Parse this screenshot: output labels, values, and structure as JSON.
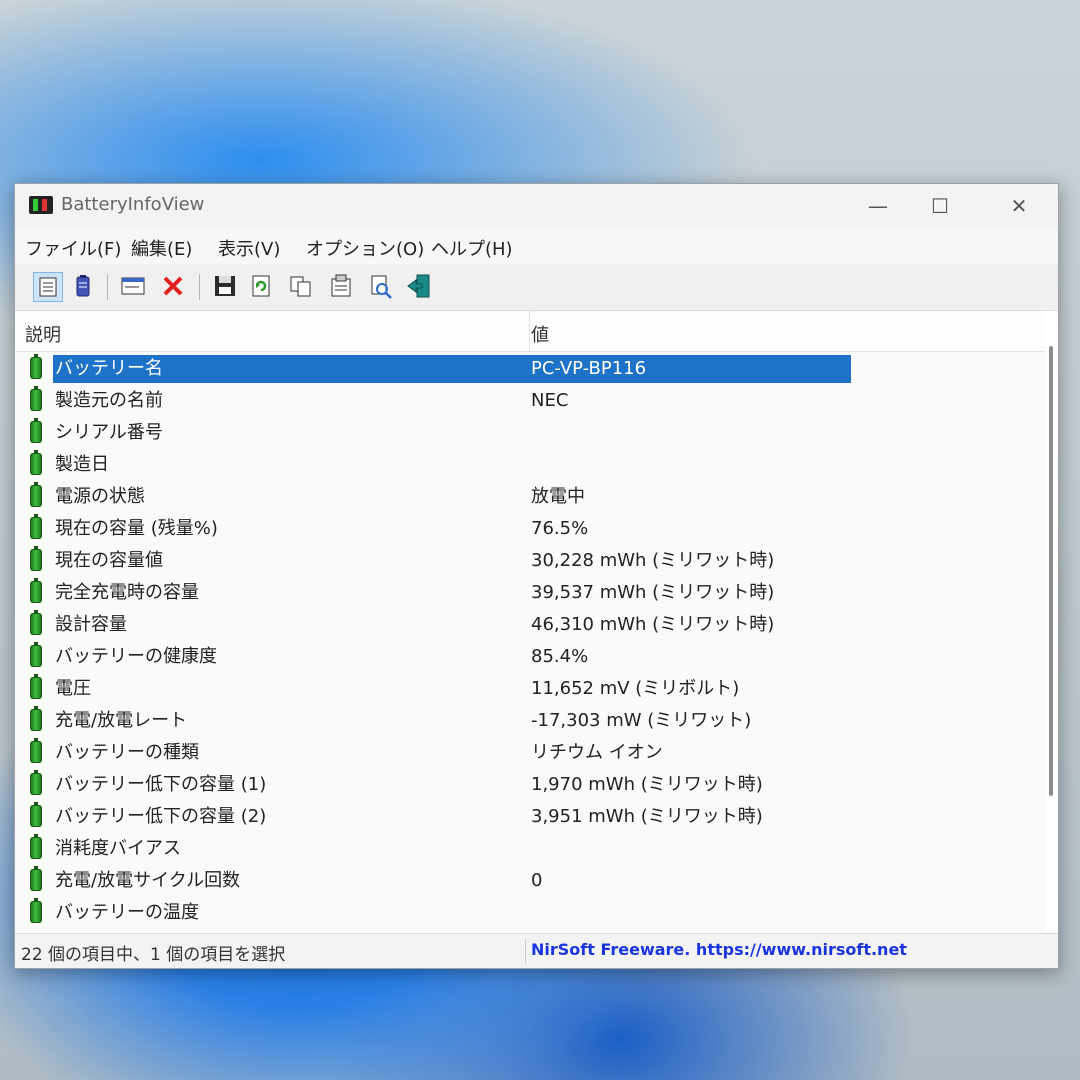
{
  "window": {
    "title": "BatteryInfoView",
    "controls": {
      "minimize": "—",
      "maximize": "☐",
      "close": "✕"
    }
  },
  "menu": [
    "ファイル(F)",
    "編集(E)",
    "表示(V)",
    "オプション(O)",
    "ヘルプ(H)"
  ],
  "toolbar": {
    "buttons": [
      "battery-info-icon",
      "battery-log-icon",
      "window-icon",
      "delete-icon",
      "save-icon",
      "refresh-icon",
      "copy-icon",
      "properties-icon",
      "html-report-icon",
      "exit-icon"
    ]
  },
  "list": {
    "columns": [
      "説明",
      "値"
    ],
    "selected_index": 0,
    "rows": [
      {
        "label": "バッテリー名",
        "value": "PC-VP-BP116"
      },
      {
        "label": "製造元の名前",
        "value": "NEC"
      },
      {
        "label": "シリアル番号",
        "value": ""
      },
      {
        "label": "製造日",
        "value": ""
      },
      {
        "label": "電源の状態",
        "value": "放電中"
      },
      {
        "label": "現在の容量 (残量%)",
        "value": "76.5%"
      },
      {
        "label": "現在の容量値",
        "value": "30,228 mWh (ミリワット時)"
      },
      {
        "label": "完全充電時の容量",
        "value": "39,537 mWh (ミリワット時)"
      },
      {
        "label": "設計容量",
        "value": "46,310 mWh (ミリワット時)"
      },
      {
        "label": "バッテリーの健康度",
        "value": "85.4%"
      },
      {
        "label": "電圧",
        "value": "11,652 mV (ミリボルト)"
      },
      {
        "label": "充電/放電レート",
        "value": "-17,303 mW (ミリワット)"
      },
      {
        "label": "バッテリーの種類",
        "value": "リチウム イオン"
      },
      {
        "label": "バッテリー低下の容量 (1)",
        "value": "1,970 mWh (ミリワット時)"
      },
      {
        "label": "バッテリー低下の容量 (2)",
        "value": "3,951 mWh (ミリワット時)"
      },
      {
        "label": "消耗度バイアス",
        "value": ""
      },
      {
        "label": "充電/放電サイクル回数",
        "value": "0"
      },
      {
        "label": "バッテリーの温度",
        "value": ""
      }
    ]
  },
  "status": {
    "summary": "22 個の項目中、1 個の項目を選択",
    "link": "NirSoft Freeware. https://www.nirsoft.net"
  },
  "colors": {
    "selection": "#1e72c8",
    "link": "#1a35e0",
    "battery_icon": "#2fa52f"
  }
}
